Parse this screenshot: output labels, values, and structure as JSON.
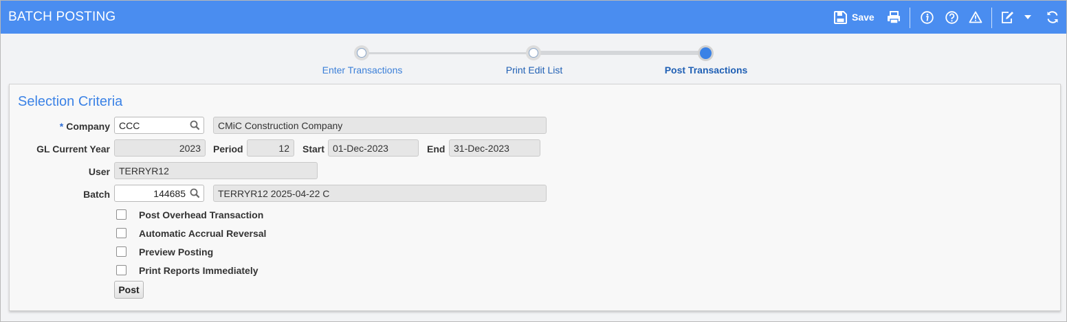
{
  "app": {
    "title": "BATCH POSTING"
  },
  "toolbar": {
    "save_label": "Save",
    "icons": [
      "save-icon",
      "print-icon",
      "info-icon",
      "help-icon",
      "warning-icon",
      "edit-icon",
      "dropdown-arrow-icon",
      "refresh-icon"
    ]
  },
  "steps": [
    {
      "label": "Enter Transactions",
      "state": "done"
    },
    {
      "label": "Print Edit List",
      "state": "done"
    },
    {
      "label": "Post Transactions",
      "state": "current"
    }
  ],
  "colors": {
    "header_bg": "#4a8df0",
    "accent": "#3b82e6",
    "step_done_text": "#3b7fd8",
    "step_current_text": "#1f5fb4",
    "step_dot": "#3b82e6"
  },
  "form": {
    "section_title": "Selection Criteria",
    "company": {
      "required_mark": "*",
      "label": "Company",
      "code": "CCC",
      "name": "CMiC Construction Company"
    },
    "gl_year": {
      "label": "GL Current Year",
      "value": "2023"
    },
    "period": {
      "label": "Period",
      "value": "12"
    },
    "start": {
      "label": "Start",
      "value": "01-Dec-2023"
    },
    "end": {
      "label": "End",
      "value": "31-Dec-2023"
    },
    "user": {
      "label": "User",
      "value": "TERRYR12"
    },
    "batch": {
      "label": "Batch",
      "number": "144685",
      "description": "TERRYR12 2025-04-22 C"
    },
    "checkboxes": [
      {
        "label": "Post Overhead Transaction",
        "checked": false
      },
      {
        "label": "Automatic Accrual Reversal",
        "checked": false
      },
      {
        "label": "Preview Posting",
        "checked": false
      },
      {
        "label": "Print Reports Immediately",
        "checked": false
      }
    ],
    "post_button": "Post"
  }
}
